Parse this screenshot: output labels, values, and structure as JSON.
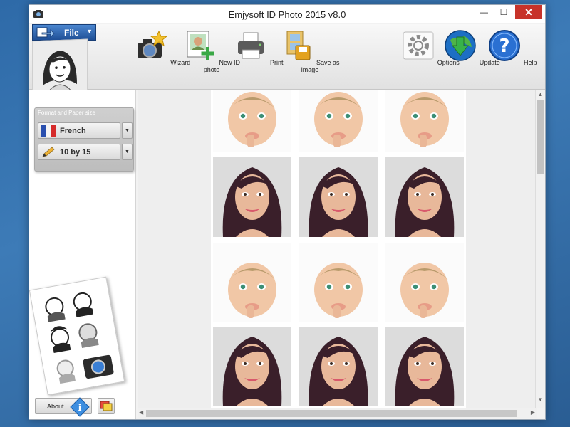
{
  "window": {
    "title": "Emjysoft ID Photo 2015 v8.0",
    "controls": {
      "minimize": "—",
      "maximize": "☐",
      "close": "✕"
    }
  },
  "ribbon": {
    "file_label": "File",
    "tools": [
      {
        "label": "Wizard",
        "icon": "wizard-camera-icon"
      },
      {
        "label": "New ID photo",
        "icon": "new-id-photo-icon"
      },
      {
        "label": "Print",
        "icon": "printer-icon"
      },
      {
        "label": "Save as image",
        "icon": "save-image-icon"
      },
      {
        "label": "Options",
        "icon": "gear-icon"
      },
      {
        "label": "Update",
        "icon": "globe-download-icon"
      },
      {
        "label": "Help",
        "icon": "help-icon"
      }
    ]
  },
  "sidebar": {
    "group_title": "Format and Paper size",
    "format_value": "French",
    "paper_value": "10 by 15",
    "about_label": "About"
  },
  "sheet": {
    "photos": [
      "baby",
      "baby",
      "baby",
      "woman",
      "woman",
      "woman",
      "baby",
      "baby",
      "baby",
      "woman",
      "woman",
      "woman"
    ]
  },
  "colors": {
    "accent": "#1f4f96",
    "close_button": "#c7332a",
    "desktop": "#2e6aa8"
  }
}
